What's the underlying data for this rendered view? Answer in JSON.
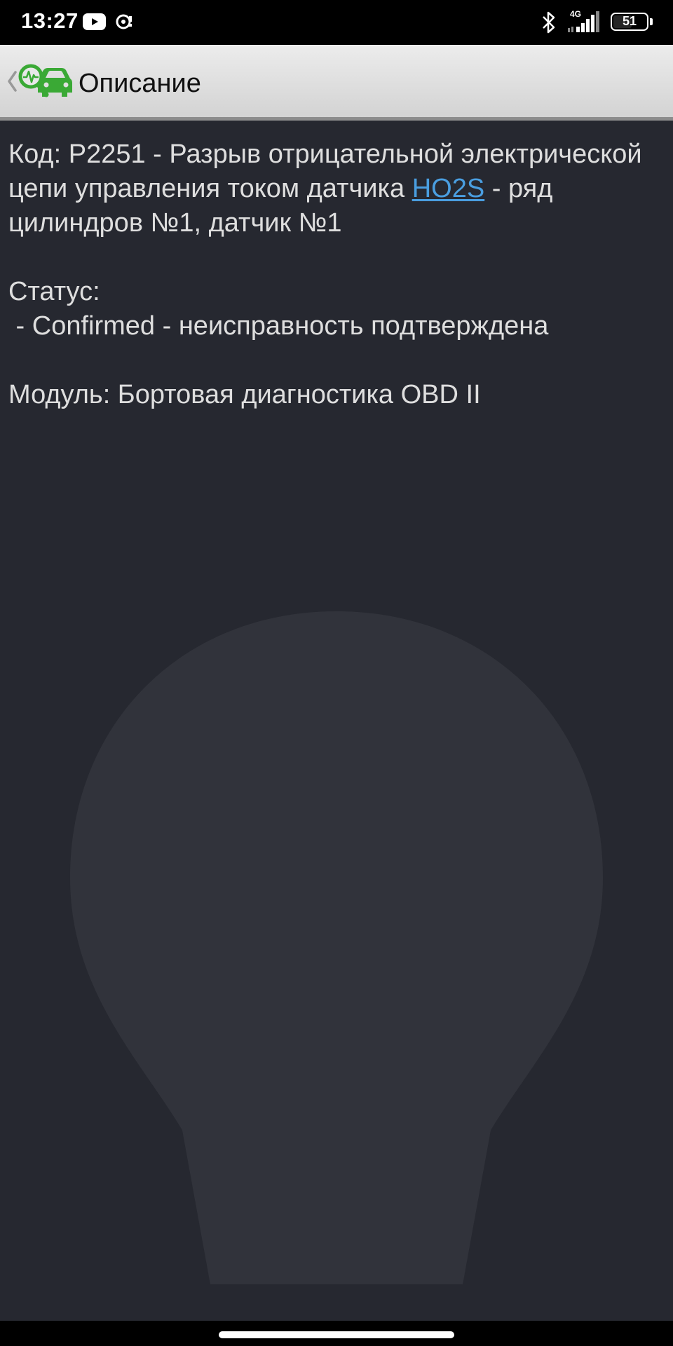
{
  "status_bar": {
    "time": "13:27",
    "network_type": "4G",
    "battery_level": "51",
    "icons": [
      "youtube-icon",
      "sync-icon",
      "bluetooth-icon",
      "signal-icon",
      "battery-icon"
    ]
  },
  "action_bar": {
    "title": "Описание",
    "icons": [
      "back-chevron-icon",
      "car-diagnostics-app-icon"
    ],
    "icon_color": "#3aa935"
  },
  "description": {
    "code_prefix": "Код: P2251 - Разрыв отрицательной электрической цепи управления током датчика ",
    "link_text": "HO2S",
    "code_suffix": " - ряд цилиндров №1, датчик №1",
    "status_label": "Статус:",
    "status_value": " - Confirmed - неисправность подтверждена",
    "module_line": "Модуль: Бортовая диагностика OBD II"
  },
  "colors": {
    "background": "#262830",
    "text": "#dedede",
    "link": "#4a9ee0"
  }
}
